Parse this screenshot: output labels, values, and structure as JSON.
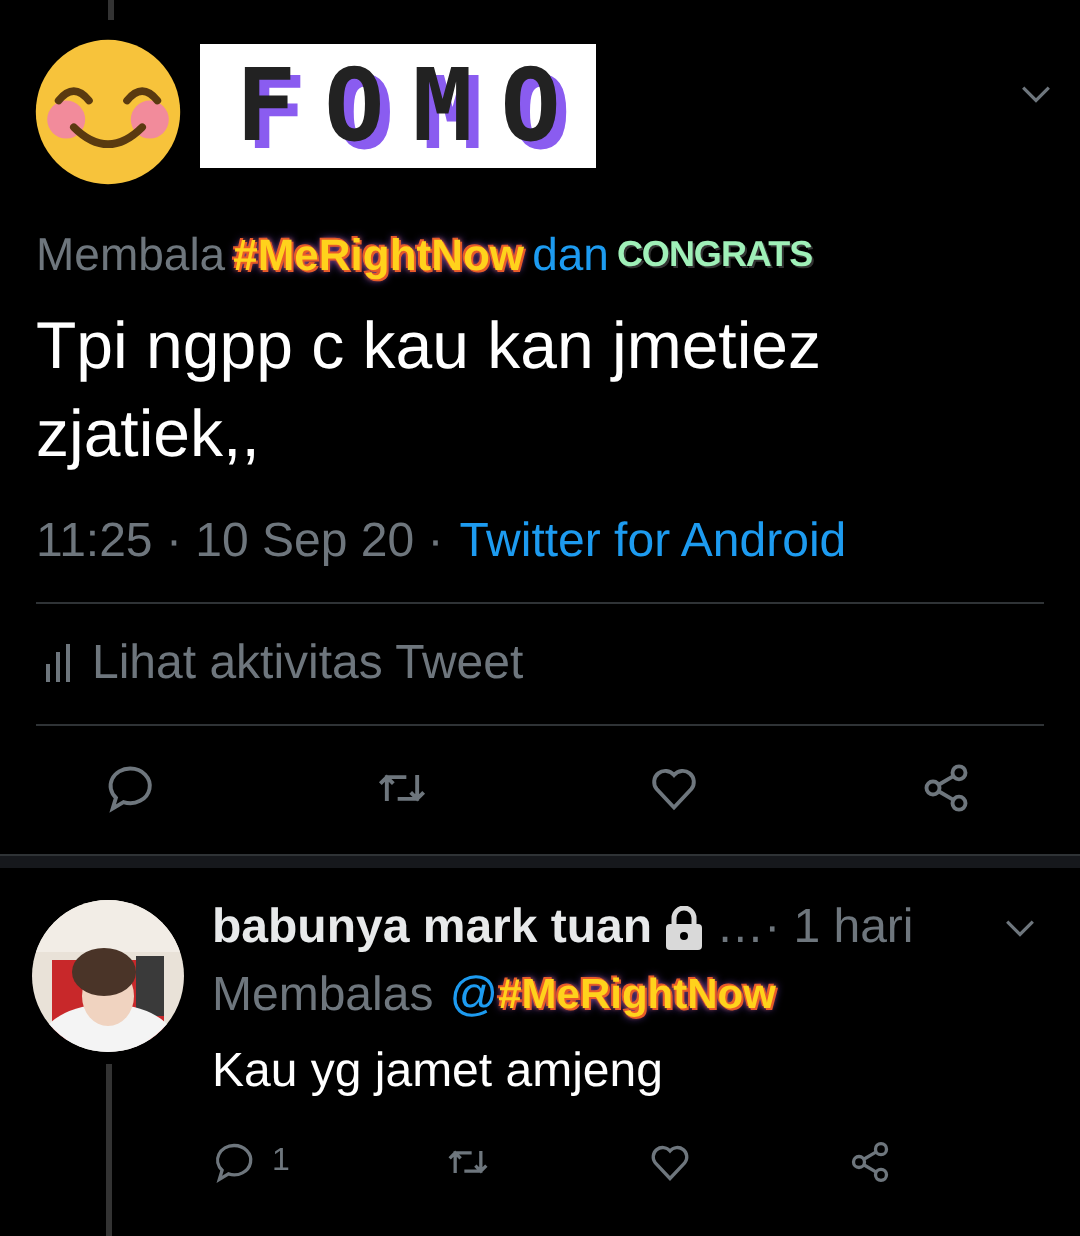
{
  "main_tweet": {
    "sticker_title": "FOMO",
    "reply_context": {
      "prefix": "Membala",
      "hashtag_sticker": "#MeRightNow",
      "conjunction": "dan",
      "congrats_sticker": "CONGRATS"
    },
    "text": "Tpi ngpp c kau kan jmetiez zjatiek,,",
    "time": "11:25 · 10 Sep 20 ·",
    "source": "Twitter for Android",
    "activity_link": "Lihat aktivitas Tweet"
  },
  "reply": {
    "name": "babunya mark tuan",
    "protected": true,
    "time": "…· 1 hari",
    "reply_prefix": "Membalas",
    "mention_start": "@",
    "hashtag_sticker": "#MeRightNow",
    "text": "Kau yg jamet amjeng",
    "reply_count": "1"
  }
}
